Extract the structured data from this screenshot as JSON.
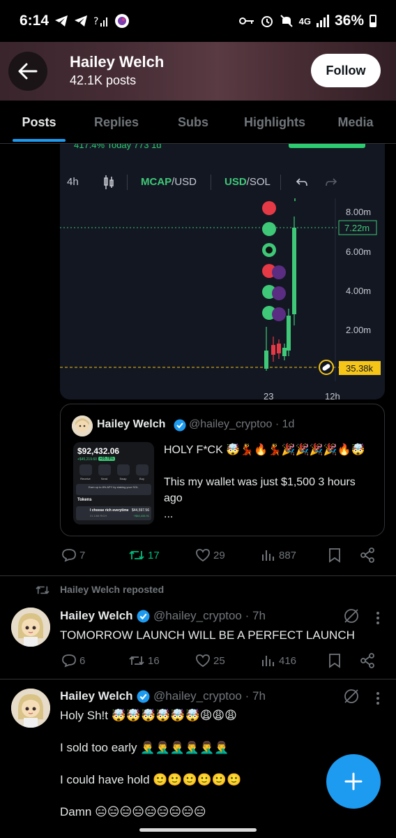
{
  "status_bar": {
    "time": "6:14",
    "battery": "36%",
    "network": "4G"
  },
  "header": {
    "name": "Hailey Welch",
    "posts": "42.1K posts",
    "follow_label": "Follow"
  },
  "tabs": [
    {
      "label": "Posts",
      "active": true
    },
    {
      "label": "Replies",
      "active": false
    },
    {
      "label": "Subs",
      "active": false
    },
    {
      "label": "Highlights",
      "active": false
    },
    {
      "label": "Media",
      "active": false
    }
  ],
  "chart_screenshot": {
    "top_text": "417.4%  Today   773   1d",
    "interval": "4h",
    "mcap_label": "MCAP",
    "mcap_suffix": "/USD",
    "usd_label": "USD",
    "usd_suffix": "/SOL",
    "price_labels": [
      "8.00m",
      "6.00m",
      "4.00m",
      "2.00m"
    ],
    "current_price": "7.22m",
    "start_price": "35.38k",
    "x_labels": [
      "23",
      "12h"
    ]
  },
  "chart_data": {
    "type": "candlestick",
    "title": "",
    "ylim": [
      0,
      8.8
    ],
    "y_ticks": [
      "8.00m",
      "6.00m",
      "4.00m",
      "2.00m"
    ],
    "current_value_label": "7.22m",
    "baseline_label": "35.38k",
    "x_ticks": [
      "23",
      "12h"
    ]
  },
  "quote": {
    "name": "Hailey Welch",
    "handle": "@hailey_cryptoo · 1d",
    "line1": "HOLY F*CK 🤯💃🔥💃🎉🎉🎉🎉🔥🤯",
    "line2": "This my wallet was just $1,500 3 hours ago",
    "line3": "...",
    "wallet_total": "$92,432.06",
    "wallet_change": "+$45,219.60",
    "wallet_pct": "+95.78%",
    "wallet_actions": [
      "Receive",
      "Send",
      "Swap",
      "Buy"
    ],
    "wallet_promo": "Earn up to 8% APY by staking your SOL",
    "wallet_tokens_label": "Tokens",
    "wallet_token_name": "I choose rich everytime",
    "wallet_token_amount": "$44,597.56",
    "wallet_token_sub": "21.13M RICH",
    "wallet_token_change": "+$44,434.91"
  },
  "post1_actions": {
    "replies": "7",
    "reposts": "17",
    "likes": "29",
    "views": "887"
  },
  "tweet2": {
    "repost_label": "Hailey Welch reposted",
    "name": "Hailey Welch",
    "handle": "@hailey_cryptoo · 7h",
    "text": "TOMORROW LAUNCH WILL BE A PERFECT LAUNCH",
    "replies": "6",
    "reposts": "16",
    "likes": "25",
    "views": "416"
  },
  "tweet3": {
    "name": "Hailey Welch",
    "handle": "@hailey_cryptoo · 7h",
    "line1": "Holy Sh!t 🤯🤯🤯🤯🤯🤯😩😩😩",
    "line2": "I sold too early 🤦‍♂️🤦‍♂️🤦‍♂️🤦‍♂️🤦‍♂️🤦‍♂️",
    "line3": "I could have hold 🙂🙂🙂🙂🙂🙂",
    "line4": "Damn 😑😑😑😑😑😑😑😑😑"
  },
  "colors": {
    "accent": "#1d9bf0",
    "repost_green": "#00ba7c",
    "chart_green": "#3fc878",
    "chart_yellow": "#f5c518"
  }
}
